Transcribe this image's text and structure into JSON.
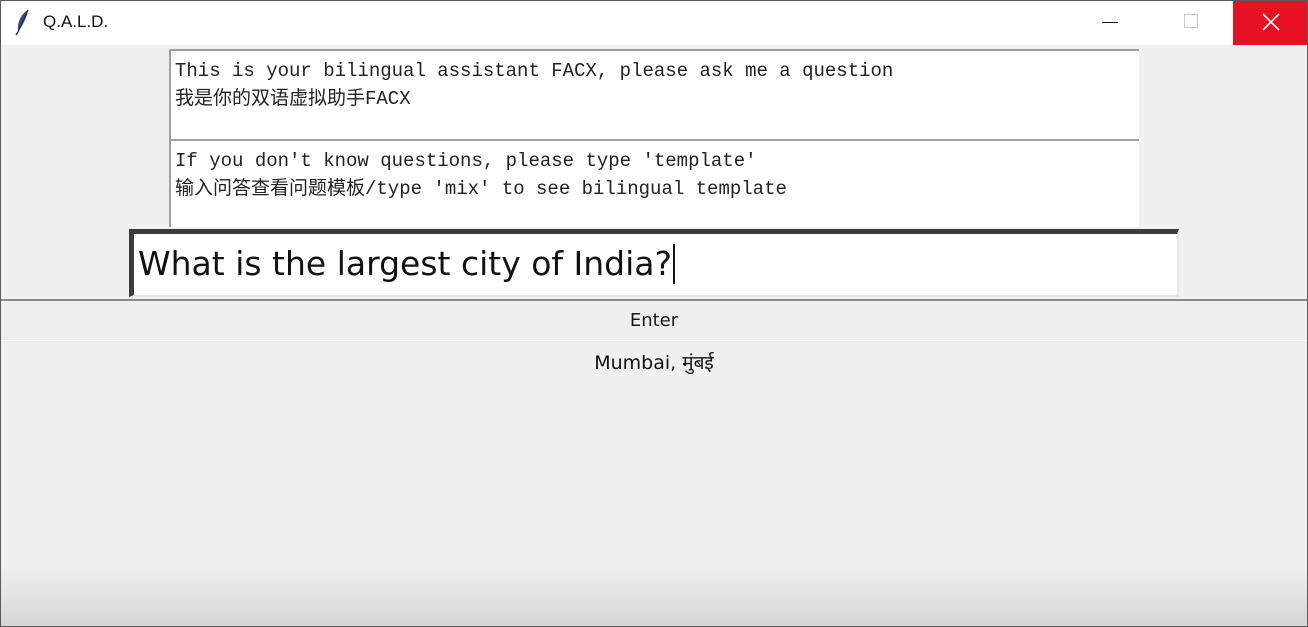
{
  "window": {
    "title": "Q.A.L.D.",
    "app_icon": "feather-icon",
    "controls": {
      "minimize_icon": "minimize-icon",
      "maximize_icon": "maximize-icon",
      "close_icon": "close-icon",
      "close_color": "#e81123"
    }
  },
  "intro_panel": {
    "line1": "This is your bilingual assistant FACX, please ask me a question",
    "line2": "我是你的双语虚拟助手FACX"
  },
  "help_panel": {
    "line1": "If you don't know questions, please type 'template'",
    "line2": "输入问答查看问题模板/type 'mix' to see bilingual template"
  },
  "question": {
    "value": "What is the largest city of India?"
  },
  "enter_button": {
    "label": "Enter"
  },
  "answer": {
    "text": "Mumbai, मुंबई"
  }
}
